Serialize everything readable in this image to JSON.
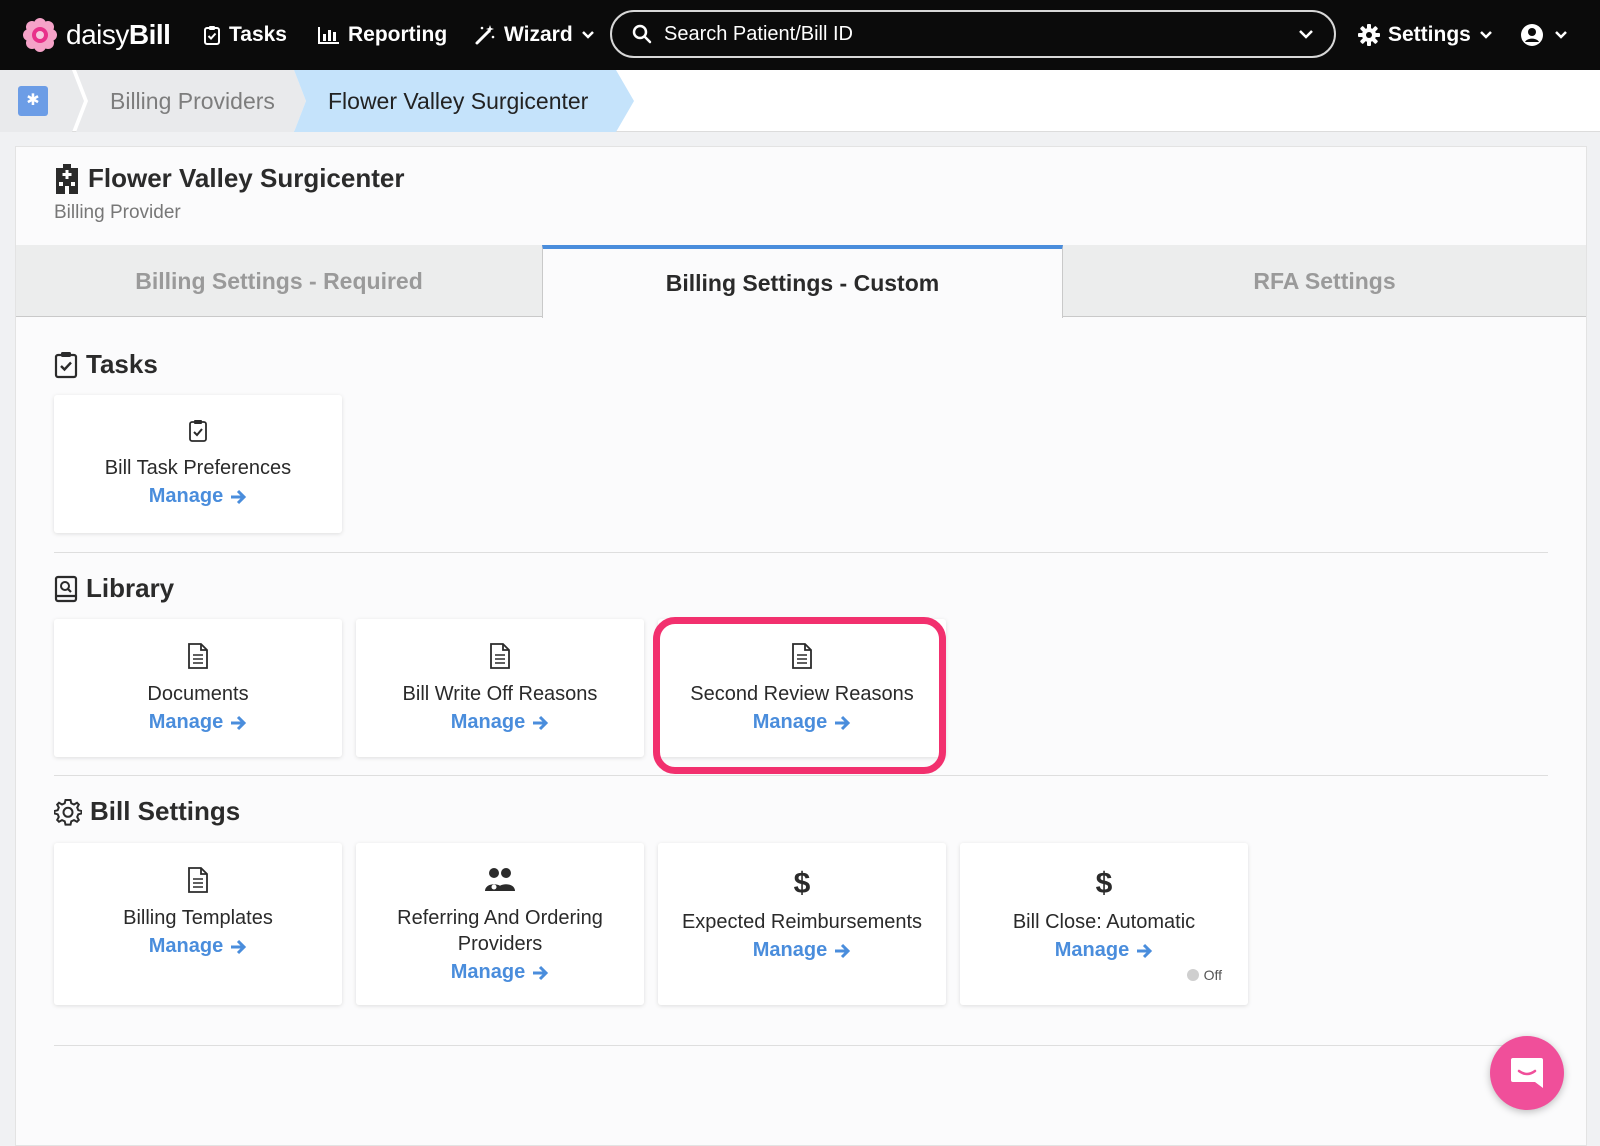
{
  "nav": {
    "brand_light": "daisy",
    "brand_bold": "Bill",
    "tasks": "Tasks",
    "reporting": "Reporting",
    "wizard": "Wizard",
    "search_placeholder": "Search Patient/Bill ID",
    "settings": "Settings"
  },
  "breadcrumb": {
    "items": [
      "Billing Providers",
      "Flower Valley Surgicenter"
    ]
  },
  "provider": {
    "name": "Flower Valley Surgicenter",
    "type": "Billing Provider"
  },
  "tabs": [
    {
      "label": "Billing Settings - Required",
      "active": false
    },
    {
      "label": "Billing Settings - Custom",
      "active": true
    },
    {
      "label": "RFA Settings",
      "active": false
    }
  ],
  "sections": {
    "tasks": {
      "title": "Tasks",
      "tiles": [
        {
          "label": "Bill Task Preferences",
          "action": "Manage",
          "icon": "clipboard-check-icon"
        }
      ]
    },
    "library": {
      "title": "Library",
      "tiles": [
        {
          "label": "Documents",
          "action": "Manage",
          "icon": "document-icon"
        },
        {
          "label": "Bill Write Off Reasons",
          "action": "Manage",
          "icon": "document-icon"
        },
        {
          "label": "Second Review Reasons",
          "action": "Manage",
          "icon": "document-icon",
          "highlighted": true
        }
      ]
    },
    "bill_settings": {
      "title": "Bill Settings",
      "tiles": [
        {
          "label": "Billing Templates",
          "action": "Manage",
          "icon": "document-icon"
        },
        {
          "label": "Referring And Ordering Providers",
          "action": "Manage",
          "icon": "users-icon"
        },
        {
          "label": "Expected Reimbursements",
          "action": "Manage",
          "icon": "dollar-icon"
        },
        {
          "label": "Bill Close: Automatic",
          "action": "Manage",
          "icon": "dollar-icon",
          "toggle": "Off"
        }
      ]
    }
  },
  "colors": {
    "accent": "#4a8ddc",
    "highlight": "#f2306e",
    "chat": "#f04f9a",
    "nav_bg": "#0b0b0b"
  }
}
